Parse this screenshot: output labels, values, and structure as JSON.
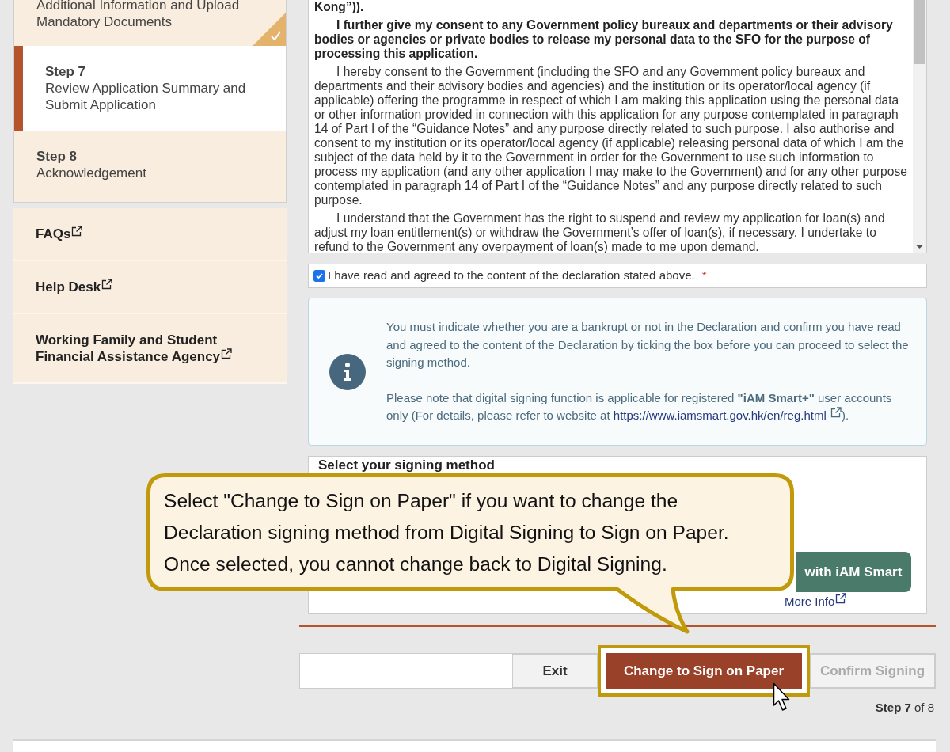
{
  "sidebar": {
    "steps": [
      {
        "description": "Additional Information and Upload Mandatory Documents",
        "selected": false,
        "completed": true
      },
      {
        "number": "Step 7",
        "description": "Review Application Summary and Submit Application",
        "selected": true,
        "completed": false
      },
      {
        "number": "Step 8",
        "description": "Acknowledgement",
        "selected": false,
        "completed": false
      }
    ],
    "links": [
      {
        "label": "FAQs"
      },
      {
        "label": "Help Desk"
      },
      {
        "label": "Working Family and Student Financial Assistance Agency"
      }
    ]
  },
  "declaration": {
    "paragraphs": [
      {
        "text": "Kong”)).",
        "bold": true,
        "continued": true
      },
      {
        "text": "I further give my consent to any Government policy bureaux and departments or their advisory bodies or agencies or private bodies to release my personal data to the SFO for the purpose of processing this application.",
        "bold": true,
        "continued": false
      },
      {
        "text": "I hereby consent to the Government (including the SFO and any Government policy bureaux and departments and their advisory bodies and agencies) and the institution or its operator/local agency (if applicable) offering the programme in respect of which I am making this application using the personal data or other information provided in connection with this application for any purpose contemplated in paragraph 14 of Part I of the “Guidance Notes” and any purpose directly related to such purpose. I also authorise and consent to my institution or its operator/local agency (if applicable) releasing personal data of which I am the subject of the data held by it to the Government in order for the Government to use such information to process my application (and any other application I may make to the Government) and for any other purpose contemplated in paragraph 14 of Part I of the “Guidance Notes” and any purpose directly related to such purpose.",
        "bold": false,
        "continued": false
      },
      {
        "text": "I understand that the Government has the right to suspend and review my application for loan(s) and adjust my loan entitlement(s) or withdraw the Government’s offer of loan(s), if necessary. I undertake to refund to the Government any overpayment of loan(s) made to me upon demand.",
        "bold": false,
        "continued": false
      }
    ]
  },
  "agreement": {
    "label": "I have read and agreed to the content of the declaration stated above.",
    "checked": true,
    "required_mark": "*"
  },
  "info": {
    "message": "You must indicate whether you are a bankrupt or not in the Declaration and confirm you have read and agreed to the content of the Declaration by ticking the box before you can proceed to select the signing method.",
    "note": "Please note that digital signing function is applicable for registered **\"iAM Smart+\"** user accounts only (For details, please refer to website at",
    "link": "https://www.iamsmart.gov.hk/en/reg.html",
    "note_end": ")."
  },
  "signing": {
    "title": "Select your signing method",
    "button": "with iAM Smart",
    "more_info": "More Info"
  },
  "actions": [
    {
      "label": "Exit",
      "kind": "secondary",
      "highlighted": false
    },
    {
      "label": "Change to Sign on Paper",
      "kind": "primary",
      "highlighted": true
    },
    {
      "label": "Confirm Signing",
      "kind": "disabled",
      "highlighted": false
    }
  ],
  "step_counter": "**Step 7** of 8",
  "callout": {
    "text": "Select \"Change to Sign on Paper\" if you want to change the Declaration signing method from Digital Signing to Sign on Paper. Once selected, you cannot change back to Digital Signing."
  }
}
